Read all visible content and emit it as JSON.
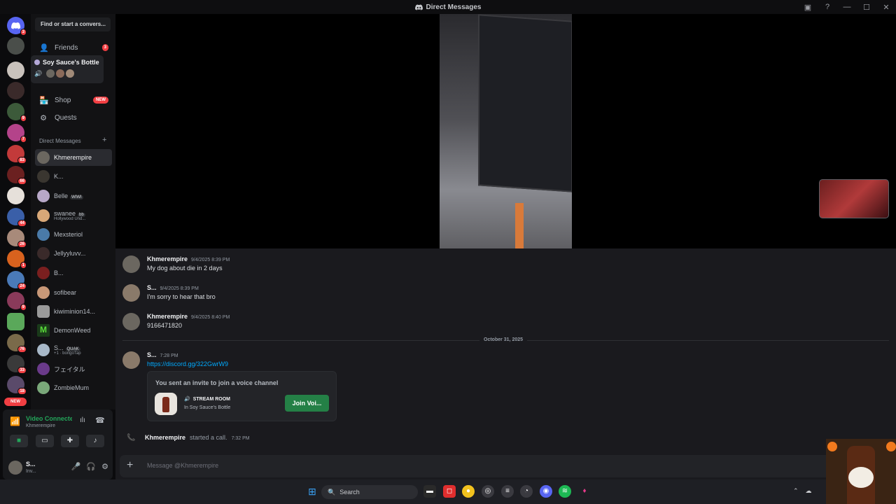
{
  "window": {
    "title": "Direct Messages"
  },
  "colors": {
    "brand": "#5865f2",
    "online": "#23a55a",
    "alert": "#f23f43",
    "link": "#00a8fc"
  },
  "guilds": {
    "items": [
      {
        "badge": "3"
      },
      {
        "badge": ""
      },
      {
        "badge": ""
      },
      {
        "badge": ""
      },
      {
        "badge": "9"
      },
      {
        "badge": "7"
      },
      {
        "badge": "83"
      },
      {
        "badge": "66"
      },
      {
        "badge": ""
      },
      {
        "badge": "44"
      },
      {
        "badge": "26"
      },
      {
        "badge": "1"
      },
      {
        "badge": "24"
      },
      {
        "badge": "9"
      },
      {
        "badge": ""
      },
      {
        "badge": "76"
      },
      {
        "badge": "33"
      },
      {
        "badge": "18"
      }
    ],
    "new_label": "NEW"
  },
  "sidebar": {
    "find_placeholder": "Find or start a convers...",
    "friends_label": "Friends",
    "friends_badge": "3",
    "shop_label": "Shop",
    "shop_badge": "NEW",
    "quests_label": "Quests",
    "dm_header": "Direct Messages"
  },
  "tooltip": {
    "title": "Soy Sauce's Bottle"
  },
  "dms": [
    {
      "name": "Khmerempire",
      "sub": "",
      "tag": ""
    },
    {
      "name": "K...",
      "sub": "",
      "tag": ""
    },
    {
      "name": "Belle",
      "sub": "",
      "tag": "WIWI"
    },
    {
      "name": "swanee",
      "sub": "Hollywood Und...",
      "tag": "bb"
    },
    {
      "name": "Mexsteriol",
      "sub": "",
      "tag": ""
    },
    {
      "name": "Jellyyluvv...",
      "sub": "",
      "tag": ""
    },
    {
      "name": "B...",
      "sub": "",
      "tag": ""
    },
    {
      "name": "sofibear",
      "sub": "",
      "tag": ""
    },
    {
      "name": "kiwiminion14...",
      "sub": "",
      "tag": ""
    },
    {
      "name": "DemonWeed",
      "sub": "",
      "tag": ""
    },
    {
      "name": "S...",
      "sub": "+1 · bongoTap",
      "tag": "QUAK"
    },
    {
      "name": "フェイタル",
      "sub": "",
      "tag": ""
    },
    {
      "name": "ZombieMum",
      "sub": "",
      "tag": ""
    }
  ],
  "voice": {
    "status": "Video Connected",
    "channel": "Khmerempire"
  },
  "user": {
    "name": "S...",
    "status": "Inv..."
  },
  "messages": [
    {
      "author": "Khmerempire",
      "time": "9/4/2025 8:39 PM",
      "text": "My dog about die in 2 days"
    },
    {
      "author": "S...",
      "time": "9/4/2025 8:39 PM",
      "text": "I'm sorry to hear that bro"
    },
    {
      "author": "Khmerempire",
      "time": "9/4/2025 8:40 PM",
      "text": "9166471820"
    },
    {
      "author": "S...",
      "time": "7:28 PM",
      "text": "https://discord.gg/322GwrW9"
    }
  ],
  "date_divider": "October 31, 2025",
  "invite": {
    "title": "You sent an invite to join a voice channel",
    "room": "STREAM ROOM",
    "server": "In Soy Sauce's Bottle",
    "join_label": "Join Voi..."
  },
  "call": {
    "author": "Khmerempire",
    "text": "started a call.",
    "time": "7:32 PM"
  },
  "composer": {
    "placeholder": "Message @Khmerempire"
  },
  "taskbar": {
    "search_label": "Search"
  }
}
